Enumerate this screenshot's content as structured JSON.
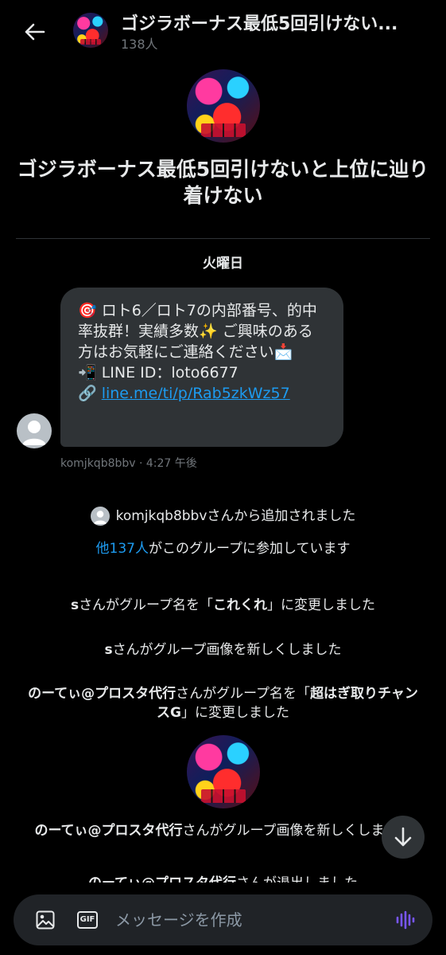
{
  "header": {
    "title": "ゴジラボーナス最低5回引けない...",
    "member_count": "138人"
  },
  "group": {
    "name": "ゴジラボーナス最低5回引けないと上位に辿り着けない"
  },
  "day_label": "火曜日",
  "message": {
    "lines": [
      "🎯 ロト6／ロト7の内部番号、的中率抜群！実績多数✨ ご興味のある方はお気軽にご連絡ください📩",
      "📲 LINE ID：loto6677"
    ],
    "link_prefix": "🔗 ",
    "link": "line.me/ti/p/Rab5zkWz57",
    "meta": "komjkqb8bbv · 4:27 午後"
  },
  "system": {
    "added_user": "komjkqb8bbv",
    "added_suffix": "さんから追加されました",
    "others_link": "他137人",
    "others_suffix": "がこのグループに参加しています",
    "rename1_user": "s",
    "rename1_mid": "さんがグループ名を「",
    "rename1_name": "これくれ",
    "rename1_end": "」に変更しました",
    "image1_user": "s",
    "image1_text": "さんがグループ画像を新しくしました",
    "rename2_user": "のーてぃ@プロスタ代行",
    "rename2_mid": "さんがグループ名を「",
    "rename2_name": "超はぎ取りチャンスG",
    "rename2_end": "」に変更しました",
    "image2_user": "のーてぃ@プロスタ代行",
    "image2_text": "さんがグループ画像を新しくしました",
    "left_user": "のーてぃ@プロスタ代行",
    "left_text": "さんが退出しました"
  },
  "composer": {
    "placeholder": "メッセージを作成",
    "gif_label": "GIF"
  },
  "colors": {
    "background": "#000000",
    "bubble": "#2f3336",
    "link": "#1d9bf0",
    "voice_accent": "#7856ff"
  }
}
